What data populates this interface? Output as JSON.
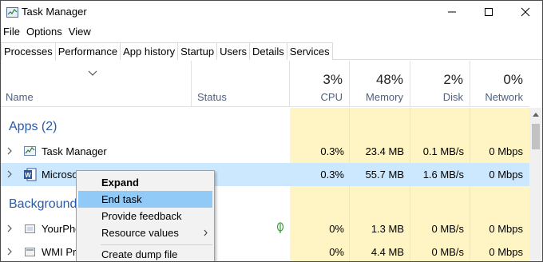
{
  "window": {
    "title": "Task Manager"
  },
  "menu": [
    "File",
    "Options",
    "View"
  ],
  "tabs": [
    "Processes",
    "Performance",
    "App history",
    "Startup",
    "Users",
    "Details",
    "Services"
  ],
  "header": {
    "name": "Name",
    "status": "Status",
    "cpu": {
      "pct": "3%",
      "label": "CPU"
    },
    "memory": {
      "pct": "48%",
      "label": "Memory"
    },
    "disk": {
      "pct": "2%",
      "label": "Disk"
    },
    "network": {
      "pct": "0%",
      "label": "Network"
    }
  },
  "groups": {
    "apps": "Apps (2)",
    "background": "Background"
  },
  "rows": [
    {
      "name": "Task Manager",
      "icon": "task-manager-icon",
      "cpu": "0.3%",
      "memory": "23.4 MB",
      "disk": "0.1 MB/s",
      "network": "0 Mbps"
    },
    {
      "name": "Microso",
      "icon": "word-icon",
      "cpu": "0.3%",
      "memory": "55.7 MB",
      "disk": "1.6 MB/s",
      "network": "0 Mbps",
      "selected": true
    },
    {
      "name": "YourPho",
      "icon": "your-phone-icon",
      "cpu": "0%",
      "memory": "1.3 MB",
      "disk": "0 MB/s",
      "network": "0 Mbps"
    },
    {
      "name": "WMI Pro",
      "icon": "wmi-icon",
      "cpu": "0%",
      "memory": "4.4 MB",
      "disk": "0 MB/s",
      "network": "0 Mbps"
    }
  ],
  "context_menu": {
    "expand": "Expand",
    "end_task": "End task",
    "feedback": "Provide feedback",
    "resource_values": "Resource values",
    "dump": "Create dump file"
  },
  "colors": {
    "accent": "#2a5aa8",
    "selection": "#cce8ff",
    "heat": "#fff4c4",
    "menu_hover": "#91c9f7"
  }
}
